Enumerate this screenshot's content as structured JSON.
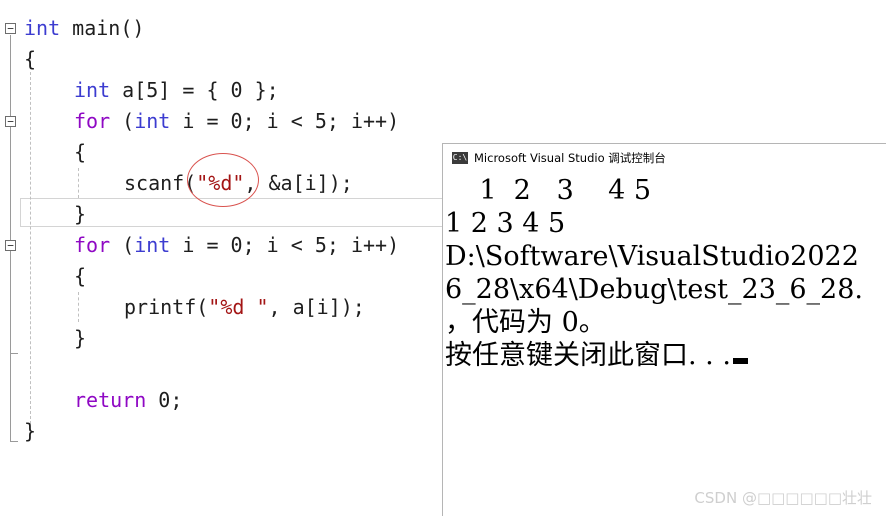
{
  "editor": {
    "code_lines": [
      {
        "parts": [
          {
            "t": "int",
            "c": "kw"
          },
          {
            "t": " main()",
            "c": ""
          }
        ]
      },
      {
        "parts": [
          {
            "t": "{",
            "c": ""
          }
        ]
      },
      {
        "parts": [
          {
            "t": "int",
            "c": "kw"
          },
          {
            "t": " a[5] = { 0 };",
            "c": ""
          }
        ]
      },
      {
        "parts": [
          {
            "t": "for",
            "c": "kw2"
          },
          {
            "t": " (",
            "c": ""
          },
          {
            "t": "int",
            "c": "kw"
          },
          {
            "t": " i = 0; i < 5; i++)",
            "c": ""
          }
        ]
      },
      {
        "parts": [
          {
            "t": "{",
            "c": ""
          }
        ]
      },
      {
        "parts": [
          {
            "t": "scanf(",
            "c": ""
          },
          {
            "t": "\"%d\"",
            "c": "str"
          },
          {
            "t": ", &a[i]);",
            "c": ""
          }
        ]
      },
      {
        "parts": [
          {
            "t": "}",
            "c": ""
          }
        ]
      },
      {
        "parts": [
          {
            "t": "for",
            "c": "kw2"
          },
          {
            "t": " (",
            "c": ""
          },
          {
            "t": "int",
            "c": "kw"
          },
          {
            "t": " i = 0; i < 5; i++)",
            "c": ""
          }
        ]
      },
      {
        "parts": [
          {
            "t": "{",
            "c": ""
          }
        ]
      },
      {
        "parts": [
          {
            "t": "printf(",
            "c": ""
          },
          {
            "t": "\"%d \"",
            "c": "str"
          },
          {
            "t": ", a[i]);",
            "c": ""
          }
        ]
      },
      {
        "parts": [
          {
            "t": "}",
            "c": ""
          }
        ]
      },
      {
        "parts": [
          {
            "t": "",
            "c": ""
          }
        ]
      },
      {
        "parts": [
          {
            "t": "return",
            "c": "kw2"
          },
          {
            "t": " 0;",
            "c": ""
          }
        ]
      },
      {
        "parts": [
          {
            "t": "}",
            "c": ""
          }
        ]
      }
    ]
  },
  "console": {
    "title": "Microsoft Visual Studio 调试控制台",
    "icon": "console-app-icon",
    "output_lines": [
      "    1  2   3    4 5",
      "1 2 3 4 5",
      "D:\\Software\\VisualStudio2022",
      "6_28\\x64\\Debug\\test_23_6_28.",
      "，代码为 0。",
      "按任意键关闭此窗口. . ."
    ]
  },
  "watermark": "CSDN @□□□□□□壮壮",
  "colors": {
    "keyword": "#3c3cd0",
    "control_keyword": "#8f08c4",
    "string": "#a31515",
    "annotation": "#d9534f"
  }
}
